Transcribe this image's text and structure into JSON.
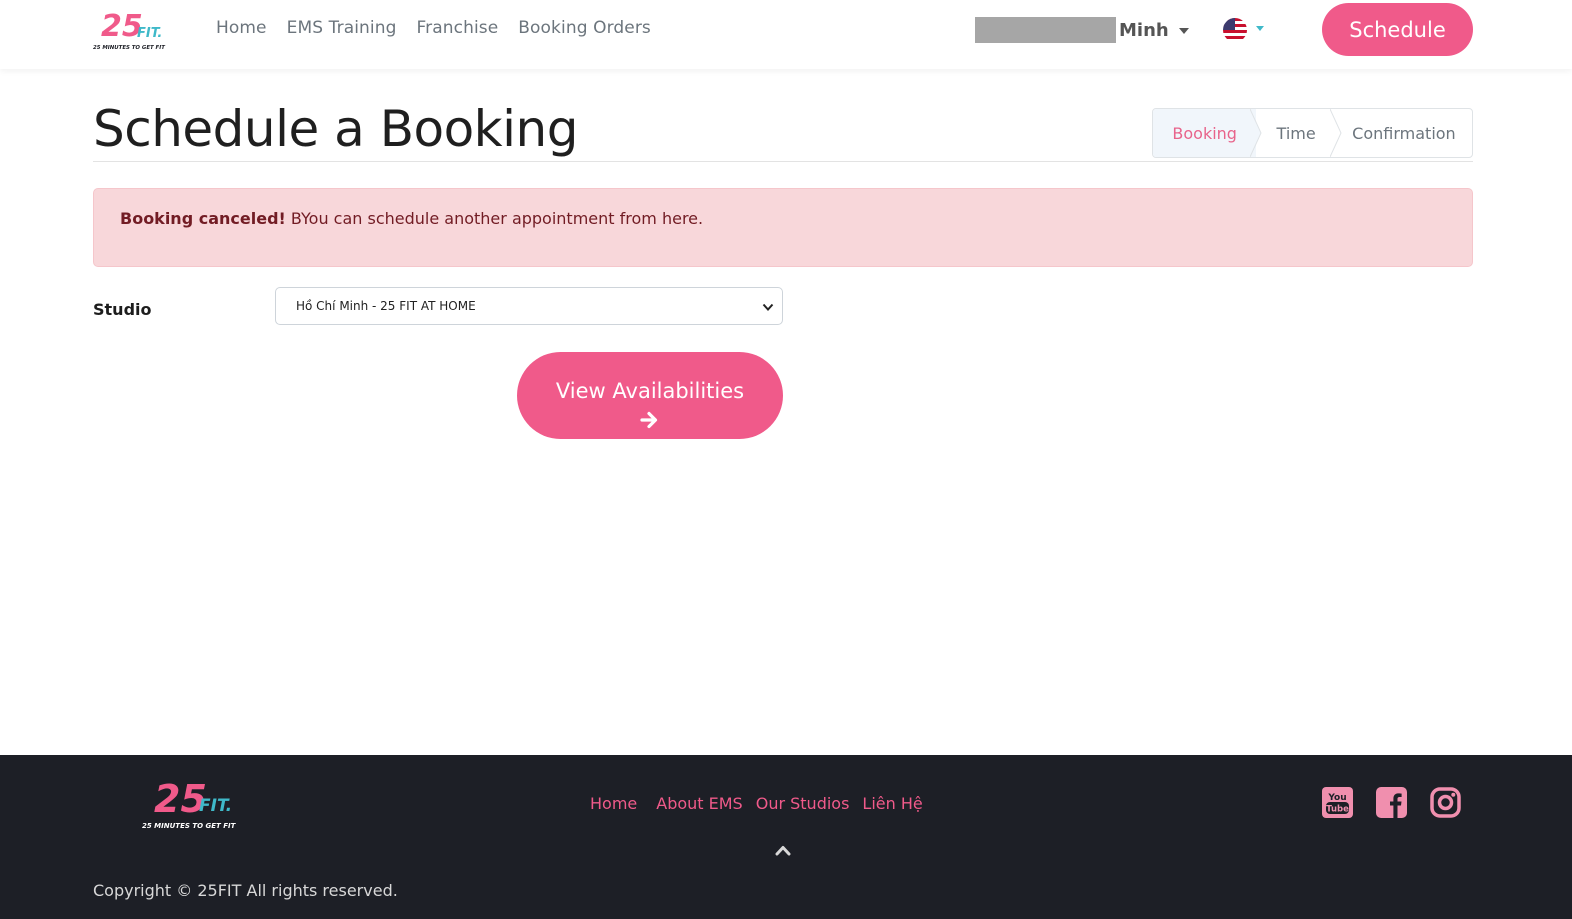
{
  "brand": {
    "logo_number": "25",
    "logo_word": "FIT.",
    "logo_tagline": "25 MINUTES TO GET FIT",
    "primary_color": "#f05a8a",
    "accent_color": "#3fb9c9"
  },
  "header": {
    "nav": [
      "Home",
      "EMS Training",
      "Franchise",
      "Booking Orders"
    ],
    "user_name": "Minh",
    "language_icon": "us-flag-icon",
    "schedule_label": "Schedule"
  },
  "page": {
    "title": "Schedule a Booking",
    "steps": [
      "Booking",
      "Time",
      "Confirmation"
    ],
    "active_step": "Booking"
  },
  "alert": {
    "strong": "Booking canceled!",
    "text": " BYou can schedule another appointment from here."
  },
  "form": {
    "studio_label": "Studio",
    "studio_selected": "Hồ Chí Minh - 25 FIT AT HOME",
    "view_button_label": "View Availabilities",
    "view_button_icon": "arrow-right-icon"
  },
  "footer": {
    "nav": [
      "Home",
      "About EMS",
      "Our Studios",
      "Liên Hệ"
    ],
    "social_icons": [
      "youtube-icon",
      "facebook-icon",
      "instagram-icon"
    ],
    "copyright": "Copyright © 25FIT All rights reserved."
  }
}
